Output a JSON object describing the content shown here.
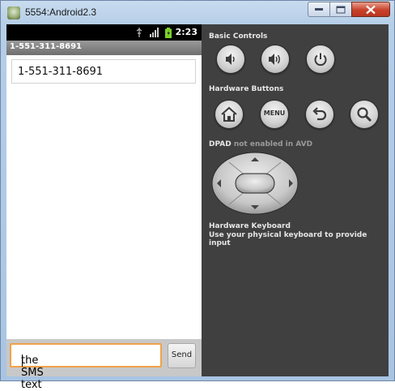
{
  "window": {
    "title": "5554:Android2.3",
    "controls": [
      "minimize-icon",
      "maximize-icon",
      "close-icon"
    ]
  },
  "phone": {
    "status": {
      "time": "2:23",
      "icons": [
        "usb-icon",
        "signal-icon",
        "battery-icon"
      ]
    },
    "conversation_title": "1-551-311-8691",
    "recipient": "1-551-311-8691",
    "compose": {
      "text": "the SMS text",
      "send_label": "Send"
    }
  },
  "panel": {
    "basic_controls": {
      "label": "Basic Controls",
      "buttons": [
        "volume-down-icon",
        "volume-up-icon",
        "power-icon"
      ]
    },
    "hardware_buttons": {
      "label": "Hardware Buttons",
      "buttons": [
        "home-icon",
        "menu-button",
        "back-icon",
        "search-icon"
      ],
      "menu_label": "MENU"
    },
    "dpad": {
      "label": "DPAD",
      "note": "not enabled in AVD"
    },
    "keyboard": {
      "label": "Hardware Keyboard",
      "note": "Use your physical keyboard to provide input"
    }
  }
}
